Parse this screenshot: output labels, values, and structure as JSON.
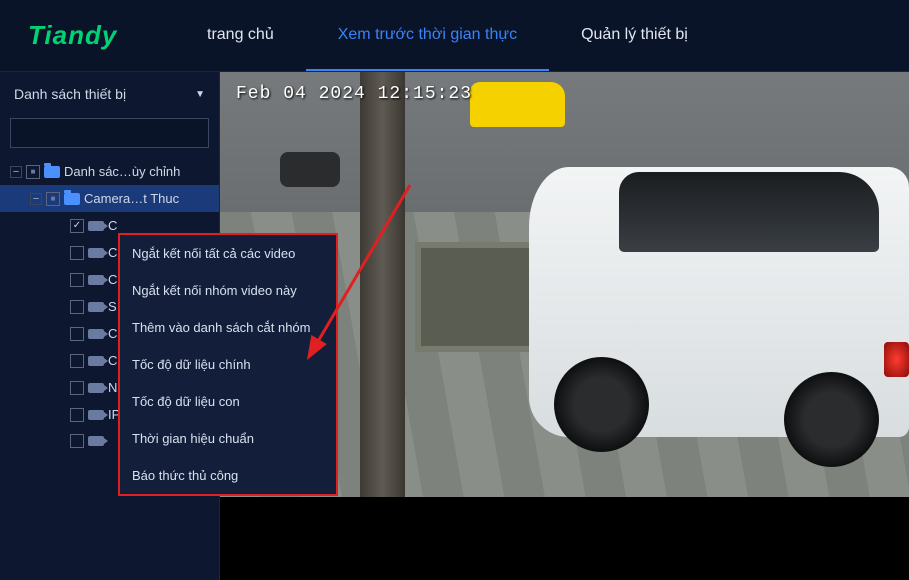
{
  "brand": "Tiandy",
  "nav": {
    "home": "trang chủ",
    "realtime": "Xem trước thời gian thực",
    "devices": "Quản lý thiết bị"
  },
  "sidebar": {
    "title": "Danh sách thiết bị",
    "search_placeholder": "",
    "root_label": "Danh sác…ùy chỉnh",
    "group_label": "Camera…t Thuc",
    "items": [
      "C",
      "C",
      "C",
      "S",
      "C",
      "C",
      "Nhìn …ng KT",
      "IPC",
      ""
    ]
  },
  "context_menu": {
    "items": [
      "Ngắt kết nối tất cả các video",
      "Ngắt kết nối nhóm video này",
      "Thêm vào danh sách cắt nhóm",
      "Tốc độ dữ liệu chính",
      "Tốc độ dữ liệu con",
      "Thời gian hiệu chuẩn",
      "Báo thức thủ công"
    ]
  },
  "video": {
    "timestamp": "Feb 04 2024 12:15:23"
  }
}
